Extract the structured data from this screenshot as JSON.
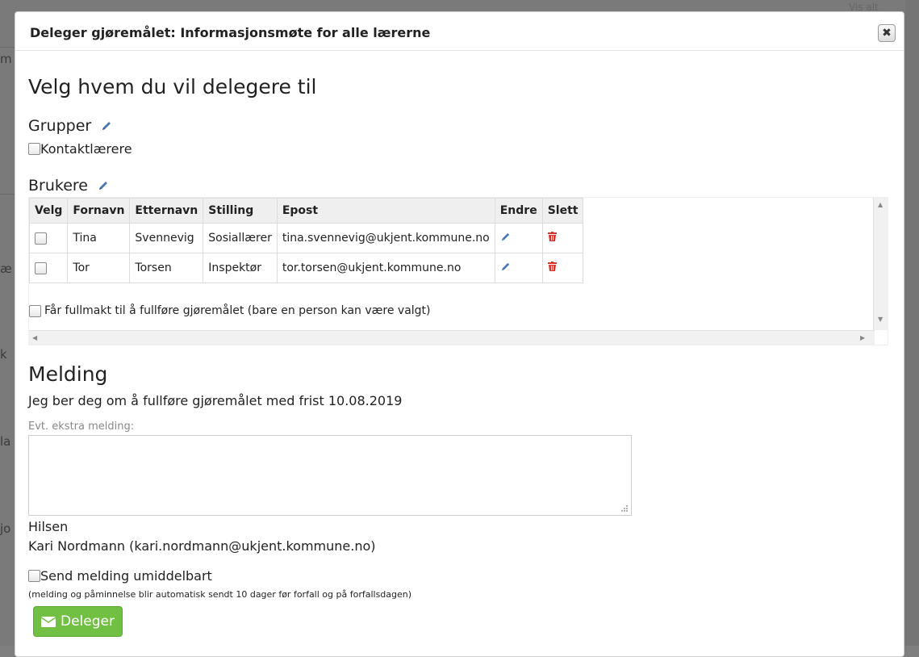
{
  "background": {
    "vis_alt": "Vis alt",
    "frag1": "m",
    "frag2": "æ",
    "frag3": "k",
    "frag4": "la",
    "frag5": "jo"
  },
  "modal": {
    "title": "Deleger gjøremålet: Informasjonsmøte for alle lærerne",
    "close_symbol": "✖",
    "heading": "Velg hvem du vil delegere til",
    "groups": {
      "label": "Grupper",
      "items": [
        {
          "label": "Kontaktlærere"
        }
      ]
    },
    "users": {
      "label": "Brukere",
      "columns": [
        "Velg",
        "Fornavn",
        "Etternavn",
        "Stilling",
        "Epost",
        "Endre",
        "Slett"
      ],
      "rows": [
        {
          "first": "Tina",
          "last": "Svennevig",
          "title": "Sosiallærer",
          "email": "tina.svennevig@ukjent.kommune.no"
        },
        {
          "first": "Tor",
          "last": "Torsen",
          "title": "Inspektør",
          "email": "tor.torsen@ukjent.kommune.no"
        }
      ],
      "fullmakt_label": "Får fullmakt til å fullføre gjøremålet (bare en person kan være valgt)"
    },
    "message": {
      "heading": "Melding",
      "text": "Jeg ber deg om å fullføre gjøremålet med frist 10.08.2019",
      "extra_label": "Evt. ekstra melding:",
      "extra_value": "",
      "greeting": "Hilsen",
      "sender": "Kari Nordmann (kari.nordmann@ukjent.kommune.no)",
      "send_now_label": "Send melding umiddelbart",
      "note": "(melding og påminnelse blir automatisk sendt 10 dager før forfall og på forfallsdagen)"
    },
    "submit_label": "Deleger"
  },
  "colors": {
    "accent_green": "#72c043",
    "pencil_blue": "#4a78b5",
    "trash_red": "#d9342b"
  }
}
